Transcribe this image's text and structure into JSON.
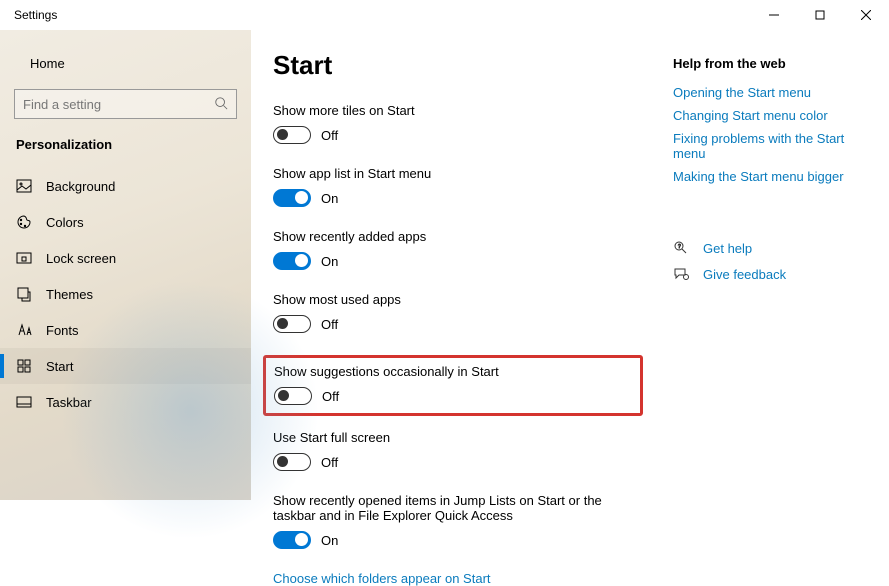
{
  "titlebar": {
    "title": "Settings"
  },
  "sidebar": {
    "home": "Home",
    "search_placeholder": "Find a setting",
    "category": "Personalization",
    "items": [
      {
        "label": "Background"
      },
      {
        "label": "Colors"
      },
      {
        "label": "Lock screen"
      },
      {
        "label": "Themes"
      },
      {
        "label": "Fonts"
      },
      {
        "label": "Start"
      },
      {
        "label": "Taskbar"
      }
    ]
  },
  "main": {
    "heading": "Start",
    "settings": [
      {
        "label": "Show more tiles on Start",
        "state": "Off",
        "on": false
      },
      {
        "label": "Show app list in Start menu",
        "state": "On",
        "on": true
      },
      {
        "label": "Show recently added apps",
        "state": "On",
        "on": true
      },
      {
        "label": "Show most used apps",
        "state": "Off",
        "on": false
      },
      {
        "label": "Show suggestions occasionally in Start",
        "state": "Off",
        "on": false
      },
      {
        "label": "Use Start full screen",
        "state": "Off",
        "on": false
      },
      {
        "label": "Show recently opened items in Jump Lists on Start or the taskbar and in File Explorer Quick Access",
        "state": "On",
        "on": true
      }
    ],
    "footer_link": "Choose which folders appear on Start"
  },
  "aside": {
    "heading": "Help from the web",
    "links": [
      "Opening the Start menu",
      "Changing Start menu color",
      "Fixing problems with the Start menu",
      "Making the Start menu bigger"
    ],
    "support": {
      "get_help": "Get help",
      "feedback": "Give feedback"
    }
  }
}
